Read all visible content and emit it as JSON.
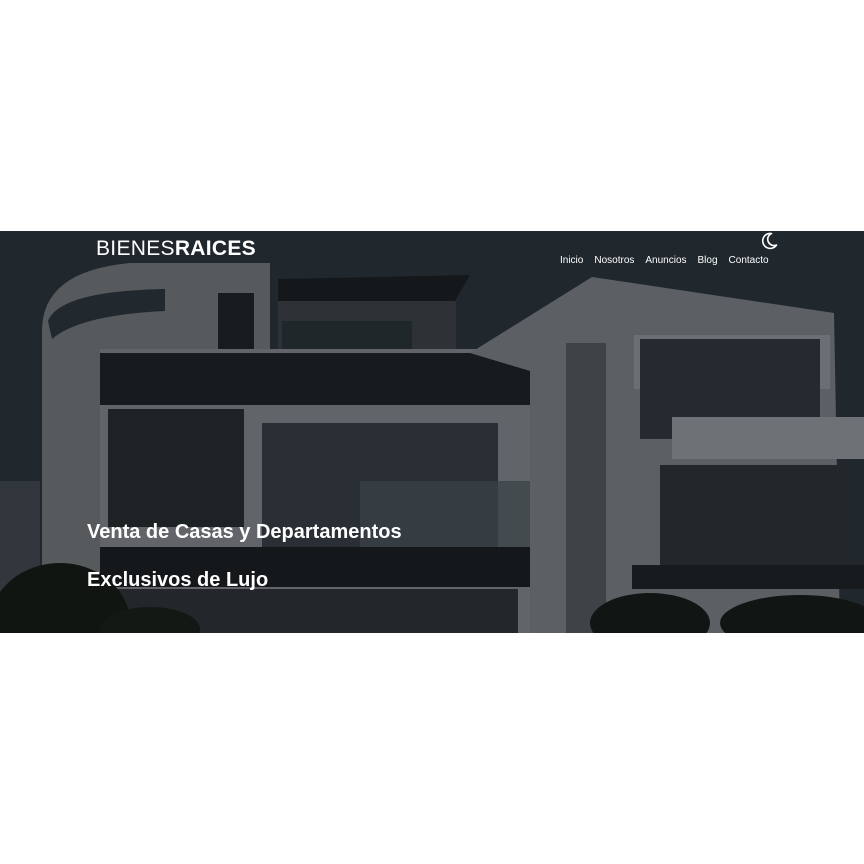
{
  "header": {
    "logo_light": "BIENES",
    "logo_bold": "RAICES",
    "dark_mode_icon": "moon-icon"
  },
  "nav": {
    "items": [
      {
        "label": "Inicio"
      },
      {
        "label": "Nosotros"
      },
      {
        "label": "Anuncios"
      },
      {
        "label": "Blog"
      },
      {
        "label": "Contacto"
      }
    ]
  },
  "hero": {
    "line1": "Venta de Casas y Departamentos",
    "line2": "Exclusivos de Lujo"
  },
  "colors": {
    "background": "#ffffff",
    "text": "#ffffff"
  }
}
